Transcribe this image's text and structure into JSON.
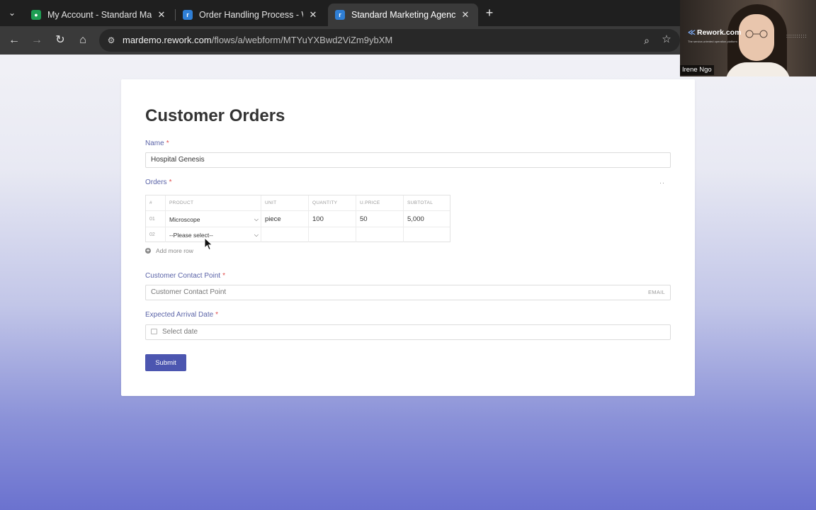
{
  "browser": {
    "tabs": [
      {
        "title": "My Account - Standard Marketi",
        "favicon": "person-icon",
        "color": "#1e9e53",
        "active": false
      },
      {
        "title": "Order Handling Process - Work",
        "favicon": "rework-icon",
        "color": "#2f7fd6",
        "active": false
      },
      {
        "title": "Standard Marketing Agency",
        "favicon": "rework-icon",
        "color": "#2f7fd6",
        "active": true
      }
    ],
    "url_host": "mardemo.rework.com",
    "url_path": "/flows/a/webform/MTYuYXBwd2ViZm9ybXM"
  },
  "form": {
    "title": "Customer Orders",
    "name_label": "Name",
    "name_value": "Hospital Genesis",
    "orders_label": "Orders",
    "orders_menu": "··",
    "table": {
      "headers": [
        "#",
        "PRODUCT",
        "UNIT",
        "QUANTITY",
        "U.PRICE",
        "SUBTOTAL"
      ],
      "rows": [
        {
          "num": "01",
          "product": "Microscope",
          "unit": "piece",
          "quantity": "100",
          "uprice": "50",
          "subtotal": "5,000"
        },
        {
          "num": "02",
          "product": "--Please select--",
          "unit": "",
          "quantity": "",
          "uprice": "",
          "subtotal": ""
        }
      ]
    },
    "add_row_label": "Add more row",
    "contact_label": "Customer Contact Point",
    "contact_placeholder": "Customer Contact Point",
    "contact_tag": "EMAIL",
    "date_label": "Expected Arrival Date",
    "date_placeholder": "Select date",
    "required_mark": "*",
    "submit_label": "Submit"
  },
  "webcam": {
    "brand": "Rework.com",
    "tagline": "The service-oriented operation platform",
    "presenter_name": "Irene Ngo"
  },
  "colors": {
    "accent": "#4c56b0",
    "label": "#5b64a8",
    "required": "#e04b4b"
  }
}
